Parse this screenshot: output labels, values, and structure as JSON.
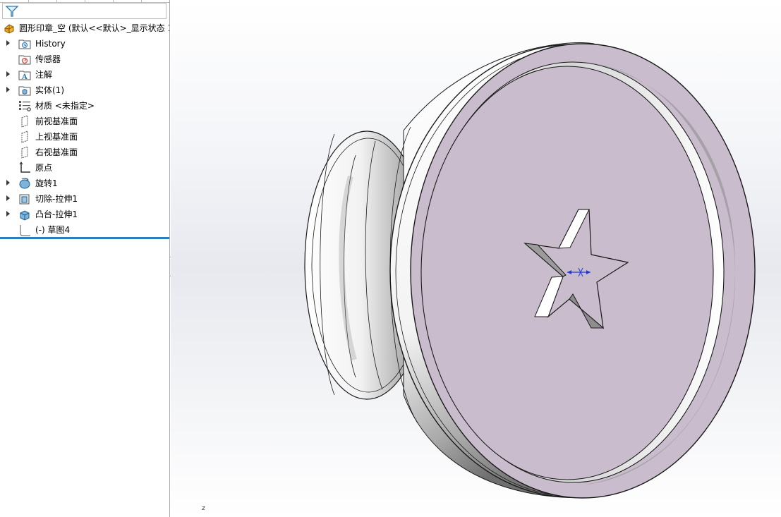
{
  "tree": {
    "filter_icon": "funnel-icon",
    "root": {
      "label": "圆形印章_空  (默认<<默认>_显示状态 1",
      "icon": "part-icon"
    },
    "items": [
      {
        "label": "History",
        "icon": "history-folder-icon",
        "expandable": true
      },
      {
        "label": "传感器",
        "icon": "sensors-folder-icon",
        "expandable": false
      },
      {
        "label": "注解",
        "icon": "annotations-folder-icon",
        "expandable": true
      },
      {
        "label": "实体(1)",
        "icon": "solid-bodies-folder-icon",
        "expandable": true
      },
      {
        "label": "材质 <未指定>",
        "icon": "material-icon",
        "expandable": false
      },
      {
        "label": "前视基准面",
        "icon": "plane-icon",
        "expandable": false
      },
      {
        "label": "上视基准面",
        "icon": "plane-icon",
        "expandable": false
      },
      {
        "label": "右视基准面",
        "icon": "plane-icon",
        "expandable": false
      },
      {
        "label": "原点",
        "icon": "origin-icon",
        "expandable": false
      },
      {
        "label": "旋转1",
        "icon": "revolve-icon",
        "expandable": true
      },
      {
        "label": "切除-拉伸1",
        "icon": "cut-extrude-icon",
        "expandable": true
      },
      {
        "label": "凸台-拉伸1",
        "icon": "boss-extrude-icon",
        "expandable": true
      },
      {
        "label": "(-) 草图4",
        "icon": "sketch-icon",
        "expandable": false
      }
    ]
  },
  "viewport": {
    "triad_z_label": "z",
    "colors": {
      "stamp_face": "#c9bccd",
      "stamp_edge": "#1a1a1a",
      "body_light": "#ffffff",
      "body_shadow": "#8c8c8c",
      "sketch_dimension": "#1f3bd6",
      "rollback_bar": "#2f7fbf"
    }
  }
}
